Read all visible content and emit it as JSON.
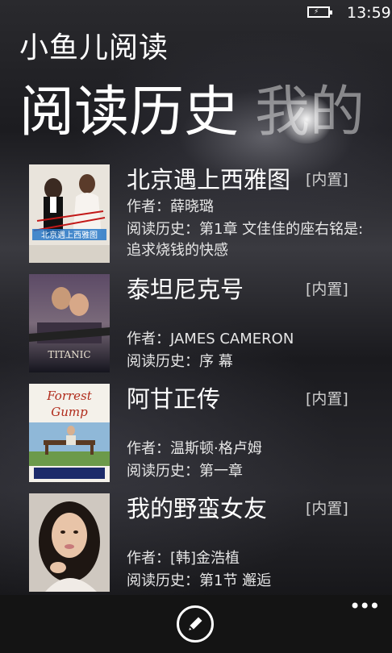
{
  "status_bar": {
    "time": "13:59",
    "battery_icon": "battery-charging-icon"
  },
  "app": {
    "title": "小鱼儿阅读"
  },
  "pivot": {
    "tabs": [
      {
        "label": "阅读历史",
        "active": true
      },
      {
        "label": "我的",
        "active": false
      }
    ]
  },
  "books": [
    {
      "title": "北京遇上西雅图",
      "badge": "[内置]",
      "author_line": "作者：薛晓璐",
      "history_line": "阅读历史：第1章 文佳佳的座右铭是:追求烧钱的快感",
      "cover_caption": "北京遇上西雅图"
    },
    {
      "title": "泰坦尼克号",
      "badge": "[内置]",
      "author_line": "作者：JAMES CAMERON",
      "history_line": "阅读历史：序 幕",
      "cover_caption": "TITANIC"
    },
    {
      "title": "阿甘正传",
      "badge": "[内置]",
      "author_line": "作者：温斯顿·格卢姆",
      "history_line": "阅读历史：第一章",
      "cover_caption_1": "Forrest",
      "cover_caption_2": "Gump"
    },
    {
      "title": "我的野蛮女友",
      "badge": "[内置]",
      "author_line": "作者：[韩]金浩植",
      "history_line": "阅读历史：第1节 邂逅"
    }
  ],
  "app_bar": {
    "edit_icon": "pencil-icon",
    "more_icon": "ellipsis-icon",
    "more_glyph": "•••"
  },
  "colors": {
    "accent": "#ffffff",
    "badge": "#cfcfcf",
    "app_bar": "#141414"
  }
}
